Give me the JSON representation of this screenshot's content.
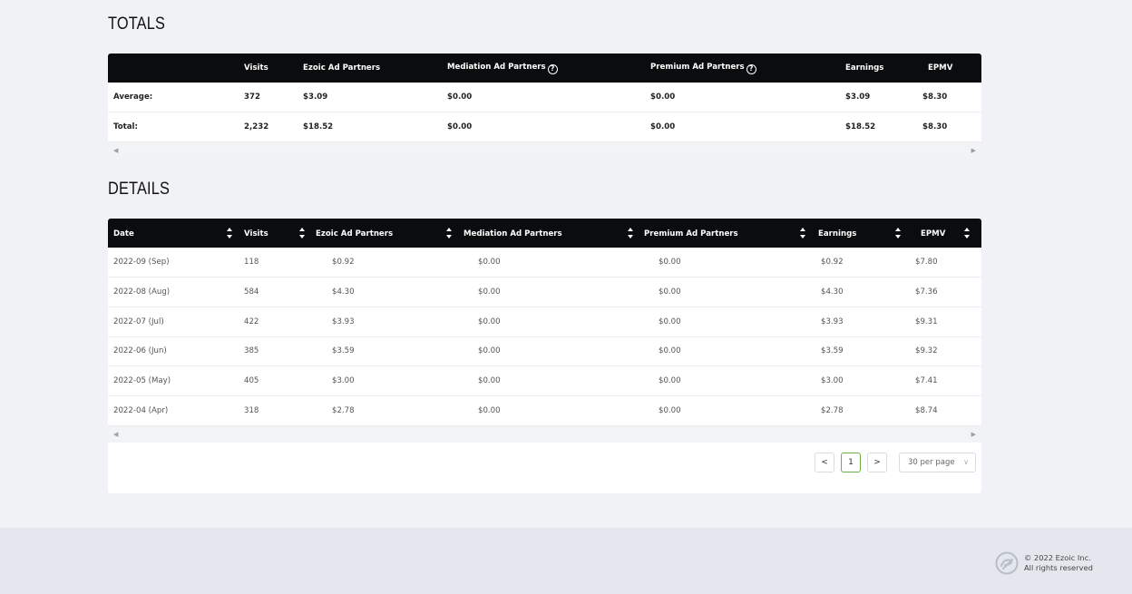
{
  "totals": {
    "title": "TOTALS",
    "headers": [
      "",
      "Visits",
      "Ezoic Ad Partners",
      "Mediation Ad Partners",
      "Premium Ad Partners",
      "Earnings",
      "EPMV"
    ],
    "rows": [
      [
        "Average:",
        "372",
        "$3.09",
        "$0.00",
        "$0.00",
        "$3.09",
        "$8.30"
      ],
      [
        "Total:",
        "2,232",
        "$18.52",
        "$0.00",
        "$0.00",
        "$18.52",
        "$8.30"
      ]
    ]
  },
  "details": {
    "title": "DETAILS",
    "headers": [
      "Date",
      "Visits",
      "Ezoic Ad Partners",
      "Mediation Ad Partners",
      "Premium Ad Partners",
      "Earnings",
      "EPMV"
    ],
    "rows": [
      [
        "2022-09 (Sep)",
        "118",
        "$0.92",
        "$0.00",
        "$0.00",
        "$0.92",
        "$7.80"
      ],
      [
        "2022-08 (Aug)",
        "584",
        "$4.30",
        "$0.00",
        "$0.00",
        "$4.30",
        "$7.36"
      ],
      [
        "2022-07 (Jul)",
        "422",
        "$3.93",
        "$0.00",
        "$0.00",
        "$3.93",
        "$9.31"
      ],
      [
        "2022-06 (Jun)",
        "385",
        "$3.59",
        "$0.00",
        "$0.00",
        "$3.59",
        "$9.32"
      ],
      [
        "2022-05 (May)",
        "405",
        "$3.00",
        "$0.00",
        "$0.00",
        "$3.00",
        "$7.41"
      ],
      [
        "2022-04 (Apr)",
        "318",
        "$2.78",
        "$0.00",
        "$0.00",
        "$2.78",
        "$8.74"
      ]
    ]
  },
  "pagination": {
    "prev": "<",
    "current_page": "1",
    "next": ">",
    "per_page": "30 per page"
  },
  "footer": {
    "copyright": "© 2022 Ezoic Inc.",
    "rights": "All rights reserved"
  },
  "icons": {
    "help": "help-circle-icon",
    "sort": "sort-icon",
    "logo": "ezoic-logo"
  },
  "colors": {
    "header_bg": "#0a0c0e",
    "page_bg": "#f0f2f5",
    "footer_bg": "#e4e8ee",
    "active_page_border": "#6cb04b"
  }
}
